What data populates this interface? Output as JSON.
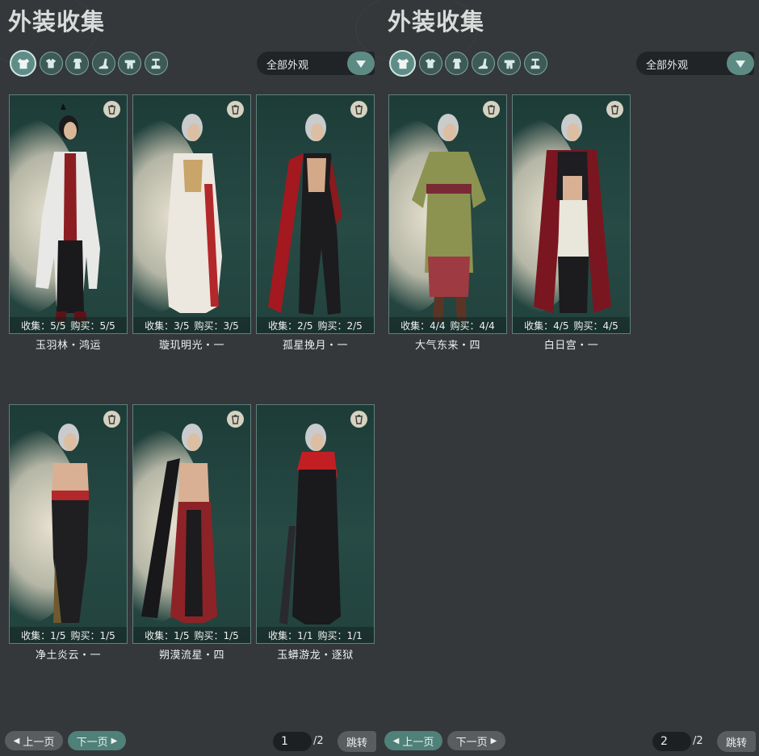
{
  "colors": {
    "background": "#34383a",
    "card_bg": "#244540",
    "accent_teal": "#5d8b84",
    "button_gray": "#5a5d5f"
  },
  "left": {
    "title": "外装收集",
    "category_icons": [
      "all-outfit-icon",
      "top-icon",
      "robe-icon",
      "boots-icon",
      "belt-icon",
      "pants-icon"
    ],
    "filter": "全部外观",
    "cards": [
      {
        "collect_label": "收集：5/5",
        "buy_label": "购买：5/5",
        "name": "玉羽林・鸿运"
      },
      {
        "collect_label": "收集：3/5",
        "buy_label": "购买：3/5",
        "name": "璇玑明光・一"
      },
      {
        "collect_label": "收集：2/5",
        "buy_label": "购买：2/5",
        "name": "孤星挽月・一"
      },
      {
        "collect_label": "收集：1/5",
        "buy_label": "购买：1/5",
        "name": "净土炎云・一"
      },
      {
        "collect_label": "收集：1/5",
        "buy_label": "购买：1/5",
        "name": "朔漠流星・四"
      },
      {
        "collect_label": "收集：1/1",
        "buy_label": "购买：1/1",
        "name": "玉蟒游龙・逐狱"
      }
    ],
    "pager": {
      "prev": "上一页",
      "next": "下一页",
      "current": "1",
      "total": "/2",
      "jump": "跳转"
    }
  },
  "right": {
    "title": "外装收集",
    "category_icons": [
      "all-outfit-icon",
      "top-icon",
      "robe-icon",
      "boots-icon",
      "belt-icon",
      "pants-icon"
    ],
    "filter": "全部外观",
    "cards": [
      {
        "collect_label": "收集：4/4",
        "buy_label": "购买：4/4",
        "name": "大气东来・四"
      },
      {
        "collect_label": "收集：4/5",
        "buy_label": "购买：4/5",
        "name": "白日宫・一"
      }
    ],
    "pager": {
      "prev": "上一页",
      "next": "下一页",
      "current": "2",
      "total": "/2",
      "jump": "跳转"
    }
  }
}
